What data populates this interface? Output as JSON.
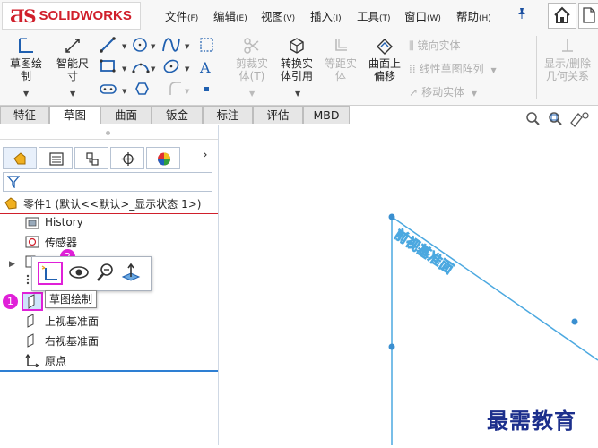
{
  "app": {
    "logo_text": "SOLIDWORKS",
    "brand_color": "#d01f2b",
    "accent_color": "#e020d8",
    "plane_color": "#4ba8e0"
  },
  "menu": {
    "items": [
      {
        "label": "文件",
        "key": "(F)"
      },
      {
        "label": "编辑",
        "key": "(E)"
      },
      {
        "label": "视图",
        "key": "(V)"
      },
      {
        "label": "插入",
        "key": "(I)"
      },
      {
        "label": "工具",
        "key": "(T)"
      },
      {
        "label": "窗口",
        "key": "(W)"
      },
      {
        "label": "帮助",
        "key": "(H)"
      }
    ],
    "pin_icon": "pin-icon",
    "home_icon": "home-icon",
    "document_icon": "new-document-icon"
  },
  "ribbon": {
    "sketch": {
      "line1": "草图绘",
      "line2": "制"
    },
    "smart_dim": {
      "line1": "智能尺",
      "line2": "寸"
    },
    "trim": {
      "line1": "剪裁实",
      "line2": "体(T)"
    },
    "convert": {
      "line1": "转换实",
      "line2": "体引用"
    },
    "offset": {
      "line1": "等距实",
      "line2": "体"
    },
    "offset_surface": {
      "line1": "曲面上",
      "line2": "偏移"
    },
    "mirror": "镜向实体",
    "linear_pattern": "线性草图阵列",
    "move": "移动实体",
    "display_relations": {
      "line1": "显示/删除",
      "line2": "几何关系"
    }
  },
  "tabs": [
    "特征",
    "草图",
    "曲面",
    "钣金",
    "标注",
    "评估",
    "MBD"
  ],
  "active_tab": "草图",
  "feature_tree": {
    "root": "零件1  (默认<<默认>_显示状态 1>)",
    "items": [
      "History",
      "传感器",
      "上视基准面",
      "右视基准面",
      "原点"
    ],
    "tabs_icons": [
      "feature-manager-icon",
      "property-manager-icon",
      "configuration-manager-icon",
      "dimxpert-icon",
      "display-manager-icon"
    ]
  },
  "context_toolbar": {
    "tooltip": "草图绘制",
    "badge_1": "1",
    "badge_2": "2"
  },
  "graphics": {
    "plane_label": "前视基准面"
  },
  "watermark": "最需教育"
}
